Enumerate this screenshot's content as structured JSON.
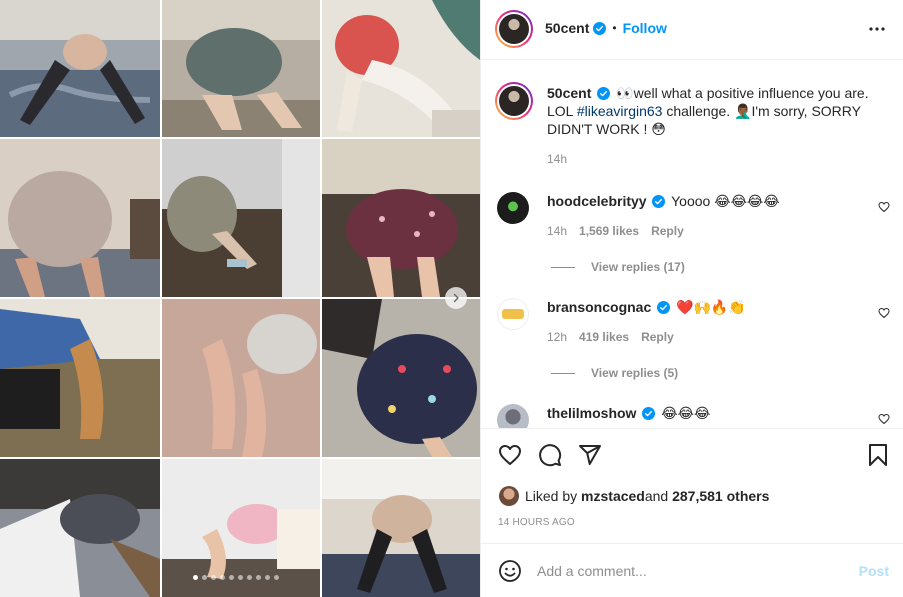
{
  "post": {
    "username": "50cent",
    "follow_label": "Follow",
    "separator": "•"
  },
  "caption": {
    "username": "50cent",
    "emoji_start": "👀",
    "text_a": "well what a positive influence you are. LOL ",
    "hashtag": "#likeavirgin63",
    "text_b": " challenge. 🤦🏾‍♂️I'm sorry, SORRY DIDN'T WORK ! 😳",
    "time": "14h"
  },
  "comments": [
    {
      "username": "hoodcelebrityy",
      "text": "Yoooo 😂😂😂😂",
      "time": "14h",
      "likes": "1,569 likes",
      "reply_label": "Reply",
      "view_replies": "View replies (17)"
    },
    {
      "username": "bransoncognac",
      "text": "❤️🙌🔥👏",
      "time": "12h",
      "likes": "419 likes",
      "reply_label": "Reply",
      "view_replies": "View replies (5)"
    },
    {
      "username": "thelilmoshow",
      "text": "😂😂😂"
    }
  ],
  "likes": {
    "prefix": "Liked by ",
    "user": "mzstaced",
    "middle": " and ",
    "count": "287,581 others"
  },
  "timestamp": "14 HOURS AGO",
  "add_comment": {
    "placeholder": "Add a comment...",
    "post_label": "Post"
  },
  "media": {
    "carousel_dots": 10,
    "active_dot": 0,
    "icon_next": "chevron-right-icon"
  },
  "colors": {
    "link": "#0095f6",
    "hashtag": "#00376b",
    "secondary": "#8e8e8e",
    "verified": "#0095f6",
    "post_disabled": "#b2dffc"
  }
}
